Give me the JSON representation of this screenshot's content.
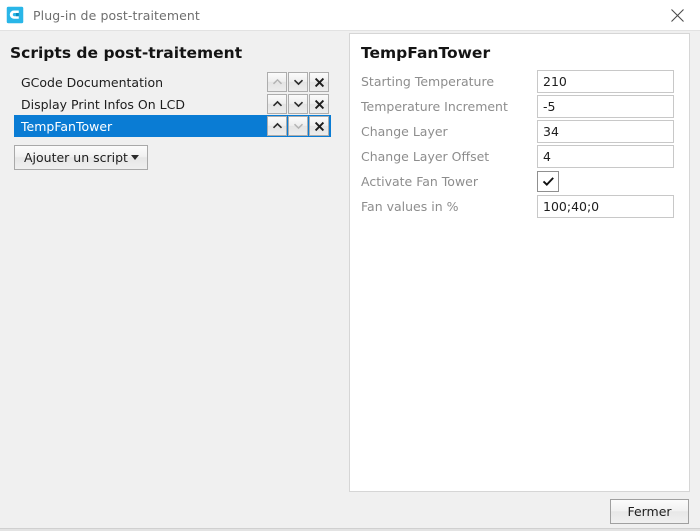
{
  "window": {
    "title": "Plug-in de post-traitement",
    "app_icon": "cura-logo-icon",
    "close_icon": "close-icon",
    "accent_color": "#0a7cd4",
    "background_color": "#f0f0f0"
  },
  "left_panel": {
    "heading": "Scripts de post-traitement",
    "scripts": [
      {
        "label": "GCode Documentation",
        "selected": false,
        "move_up_enabled": false,
        "move_down_enabled": true,
        "remove_enabled": true
      },
      {
        "label": "Display Print Infos On LCD",
        "selected": false,
        "move_up_enabled": true,
        "move_down_enabled": true,
        "remove_enabled": true
      },
      {
        "label": "TempFanTower",
        "selected": true,
        "move_up_enabled": true,
        "move_down_enabled": false,
        "remove_enabled": true
      }
    ],
    "row_icons": {
      "up": "chevron-up-icon",
      "down": "chevron-down-icon",
      "remove": "close-x-icon"
    },
    "add_script_button": {
      "label": "Ajouter un script",
      "caret_icon": "caret-down-icon"
    }
  },
  "right_panel": {
    "title": "TempFanTower",
    "fields": [
      {
        "label": "Starting Temperature",
        "type": "text",
        "value": "210",
        "placeholder": ""
      },
      {
        "label": "Temperature Increment",
        "type": "text",
        "value": "-5",
        "placeholder": ""
      },
      {
        "label": "Change Layer",
        "type": "text",
        "value": "34",
        "placeholder": ""
      },
      {
        "label": "Change Layer Offset",
        "type": "text",
        "value": "4",
        "placeholder": ""
      },
      {
        "label": "Activate Fan Tower",
        "type": "checkbox",
        "value": "checked",
        "placeholder": ""
      },
      {
        "label": "Fan values in %",
        "type": "text",
        "value": "100;40;0",
        "placeholder": ""
      }
    ],
    "checkbox_icon": "check-icon"
  },
  "footer": {
    "close_button_label": "Fermer"
  }
}
